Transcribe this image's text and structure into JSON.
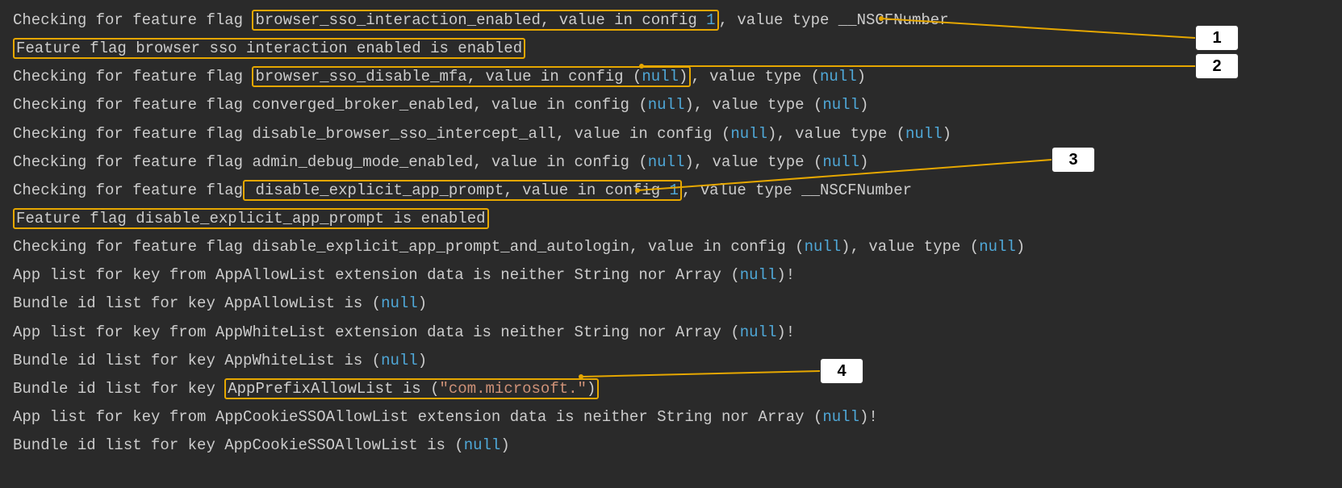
{
  "lines": {
    "l1_prefix": "Checking for feature flag ",
    "l1_box": "browser_sso_interaction_enabled, value in config ",
    "l1_num": "1",
    "l1_suffix": ", value type __NSCFNumber",
    "l2_box": "Feature flag browser sso interaction enabled is enabled",
    "l3_prefix": "Checking for feature flag ",
    "l3_box_a": "browser_sso_disable_mfa, value in config (",
    "l3_box_null": "null",
    "l3_box_b": ")",
    "l3_suffix_a": ", value type (",
    "l3_null2": "null",
    "l3_suffix_b": ")",
    "l4_prefix": "Checking for feature flag converged_broker_enabled, value in config (",
    "l4_null1": "null",
    "l4_mid": "), value type (",
    "l4_null2": "null",
    "l4_end": ")",
    "l5_prefix": "Checking for feature flag disable_browser_sso_intercept_all, value in config (",
    "l5_null1": "null",
    "l5_mid": "), value type (",
    "l5_null2": "null",
    "l5_end": ")",
    "l6_prefix": "Checking for feature flag admin_debug_mode_enabled, value in config (",
    "l6_null1": "null",
    "l6_mid": "), value type (",
    "l6_null2": "null",
    "l6_end": ")",
    "l7_prefix": "Checking for feature flag",
    "l7_box": " disable_explicit_app_prompt, value in config ",
    "l7_num": "1",
    "l7_suffix": ", value type __NSCFNumber",
    "l8_box": "Feature flag disable_explicit_app_prompt is enabled",
    "l9_prefix": "Checking for feature flag disable_explicit_app_prompt_and_autologin, value in config (",
    "l9_null1": "null",
    "l9_mid": "), value type (",
    "l9_null2": "null",
    "l9_end": ")",
    "l10_prefix": "App list for key from AppAllowList extension data is neither String nor Array (",
    "l10_null": "null",
    "l10_end": ")!",
    "l11_prefix": "Bundle id list for key AppAllowList is (",
    "l11_null": "null",
    "l11_end": ")",
    "l12_prefix": "App list for key from AppWhiteList extension data is neither String nor Array (",
    "l12_null": "null",
    "l12_end": ")!",
    "l13_prefix": "Bundle id list for key AppWhiteList is (",
    "l13_null": "null",
    "l13_end": ")",
    "l14_prefix": "Bundle id list for key ",
    "l14_box_a": "AppPrefixAllowList is (",
    "l14_str": "\"com.microsoft.\"",
    "l14_box_b": ")",
    "l15_prefix": "App list for key from AppCookieSSOAllowList extension data is neither String nor Array (",
    "l15_null": "null",
    "l15_end": ")!",
    "l16_prefix": "Bundle id list for key AppCookieSSOAllowList is (",
    "l16_null": "null",
    "l16_end": ")"
  },
  "callouts": {
    "c1": "1",
    "c2": "2",
    "c3": "3",
    "c4": "4"
  }
}
